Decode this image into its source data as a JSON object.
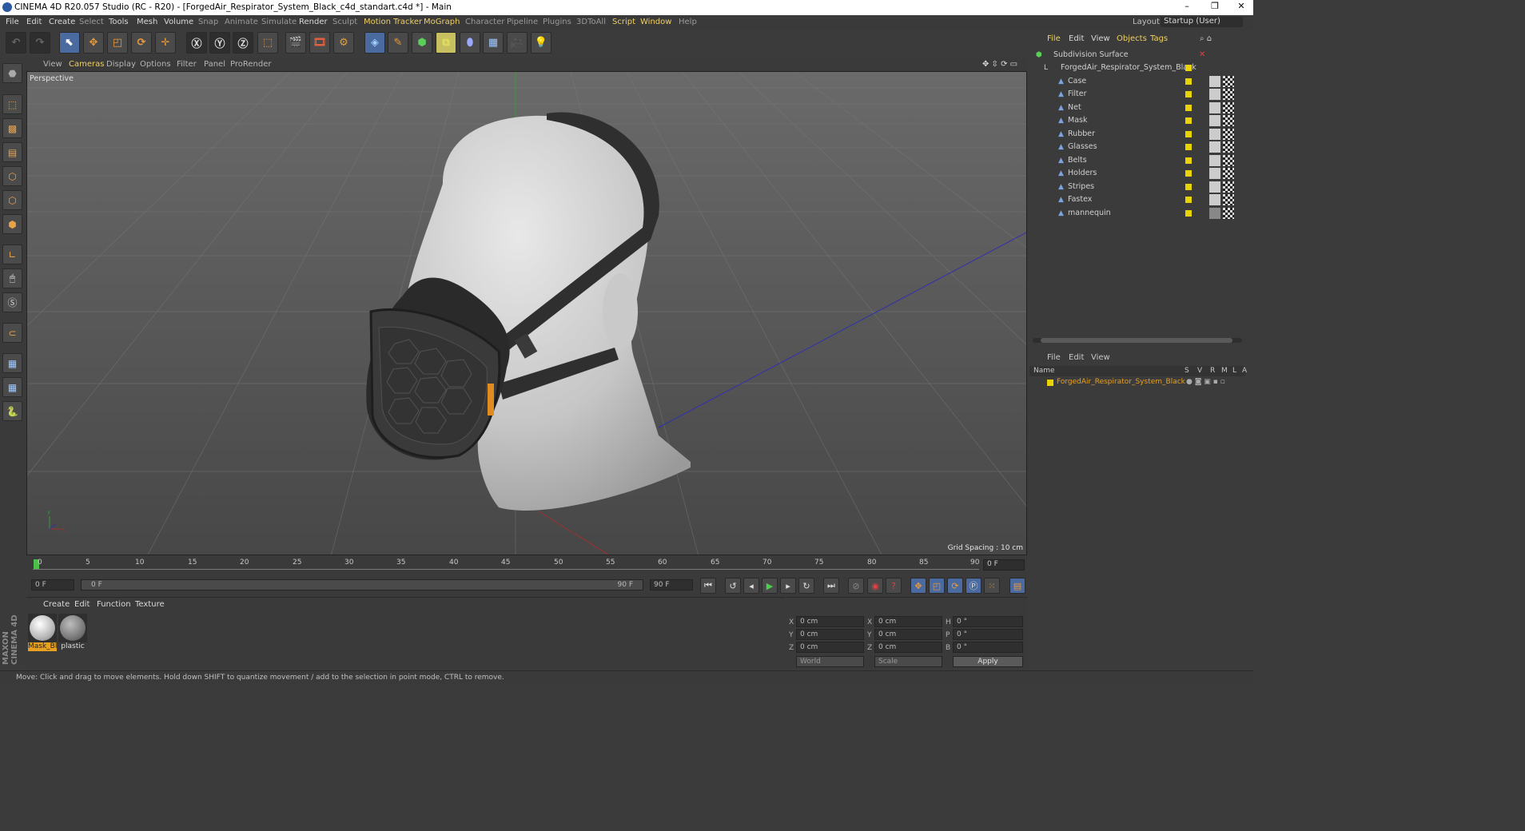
{
  "window": {
    "title": "CINEMA 4D R20.057 Studio (RC - R20) - [ForgedAir_Respirator_System_Black_c4d_standart.c4d *] - Main",
    "layout_label": "Layout:",
    "layout_value": "Startup (User)"
  },
  "menu": [
    "File",
    "Edit",
    "Create",
    "Select",
    "Tools",
    "Mesh",
    "Volume",
    "Snap",
    "Animate",
    "Simulate",
    "Render",
    "Sculpt",
    "Motion Tracker",
    "MoGraph",
    "Character",
    "Pipeline",
    "Plugins",
    "3DToAll",
    "Script",
    "Window",
    "Help"
  ],
  "viewport": {
    "menu": [
      "View",
      "Cameras",
      "Display",
      "Options",
      "Filter",
      "Panel",
      "ProRender"
    ],
    "label": "Perspective",
    "grid_spacing": "Grid Spacing : 10 cm"
  },
  "timeline": {
    "ticks": [
      "0",
      "5",
      "10",
      "15",
      "20",
      "25",
      "30",
      "35",
      "40",
      "45",
      "50",
      "55",
      "60",
      "65",
      "70",
      "75",
      "80",
      "85",
      "90"
    ],
    "frame_indicator": "0 F",
    "start_field": "0 F",
    "slider_start": "0 F",
    "slider_end": "90 F",
    "end_field": "90 F"
  },
  "material_manager": {
    "menu": [
      "Create",
      "Edit",
      "Function",
      "Texture"
    ],
    "materials": [
      {
        "name": "Mask_Bl",
        "color": "#d8d8d8",
        "selected": true
      },
      {
        "name": "plastic",
        "color": "#8a8a8a",
        "selected": false
      }
    ]
  },
  "coordinates": {
    "rows": [
      {
        "a_label": "X",
        "a_val": "0 cm",
        "b_label": "X",
        "b_val": "0 cm",
        "c_label": "H",
        "c_val": "0 °"
      },
      {
        "a_label": "Y",
        "a_val": "0 cm",
        "b_label": "Y",
        "b_val": "0 cm",
        "c_label": "P",
        "c_val": "0 °"
      },
      {
        "a_label": "Z",
        "a_val": "0 cm",
        "b_label": "Z",
        "b_val": "0 cm",
        "c_label": "B",
        "c_val": "0 °"
      }
    ],
    "world": "World",
    "scale": "Scale",
    "apply": "Apply"
  },
  "object_manager": {
    "menu": [
      "File",
      "Edit",
      "View",
      "Objects",
      "Tags"
    ],
    "objects": [
      {
        "name": "Subdivision Surface",
        "level": 0
      },
      {
        "name": "ForgedAir_Respirator_System_Black",
        "level": 1
      },
      {
        "name": "Case",
        "level": 2
      },
      {
        "name": "Filter",
        "level": 2
      },
      {
        "name": "Net",
        "level": 2
      },
      {
        "name": "Mask",
        "level": 2
      },
      {
        "name": "Rubber",
        "level": 2
      },
      {
        "name": "Glasses",
        "level": 2
      },
      {
        "name": "Belts",
        "level": 2
      },
      {
        "name": "Holders",
        "level": 2
      },
      {
        "name": "Stripes",
        "level": 2
      },
      {
        "name": "Fastex",
        "level": 2
      },
      {
        "name": "mannequin",
        "level": 2
      }
    ]
  },
  "layer_manager": {
    "menu": [
      "File",
      "Edit",
      "View"
    ],
    "columns": [
      "Name",
      "S",
      "V",
      "R",
      "M",
      "L",
      "A"
    ],
    "row": "ForgedAir_Respirator_System_Black"
  },
  "status": "Move: Click and drag to move elements. Hold down SHIFT to quantize movement / add to the selection in point mode, CTRL to remove.",
  "brand": "MAXON CINEMA 4D",
  "colors": {
    "accent": "#f0d060",
    "layer_yellow": "#e8d400",
    "selection_blue": "#4a6aa0"
  }
}
